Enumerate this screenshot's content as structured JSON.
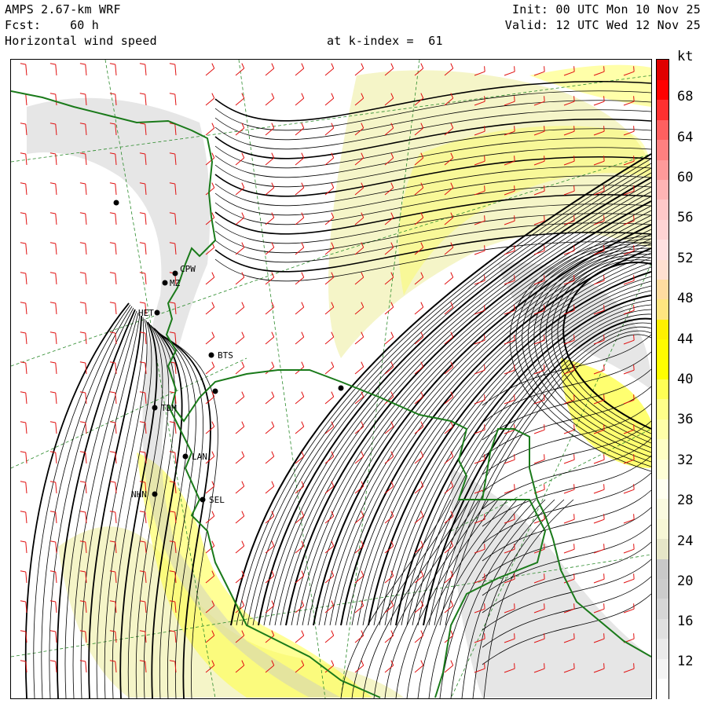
{
  "header": {
    "model": "AMPS 2.67-km WRF",
    "forecast": "Fcst:    60 h",
    "field": "Horizontal wind speed",
    "level": "at k-index =  61",
    "init": "Init: 00 UTC Mon 10 Nov 25",
    "valid": "Valid: 12 UTC Wed 12 Nov 25"
  },
  "colorbar": {
    "unit": "kt",
    "labels": [
      "68",
      "64",
      "60",
      "56",
      "52",
      "48",
      "44",
      "40",
      "36",
      "32",
      "28",
      "24",
      "20",
      "16",
      "12"
    ],
    "levels": [
      {
        "min": 0,
        "color": "#ffffff"
      },
      {
        "min": 10,
        "color": "#f4f4f4"
      },
      {
        "min": 12,
        "color": "#eaeaea"
      },
      {
        "min": 14,
        "color": "#e0e0e0"
      },
      {
        "min": 16,
        "color": "#d6d6d6"
      },
      {
        "min": 18,
        "color": "#cccccc"
      },
      {
        "min": 20,
        "color": "#c8c8c8"
      },
      {
        "min": 22,
        "color": "#e6e6c8"
      },
      {
        "min": 24,
        "color": "#f7f7d6"
      },
      {
        "min": 26,
        "color": "#fafae0"
      },
      {
        "min": 28,
        "color": "#fffff0"
      },
      {
        "min": 30,
        "color": "#ffffd6"
      },
      {
        "min": 32,
        "color": "#ffffc4"
      },
      {
        "min": 34,
        "color": "#ffffa8"
      },
      {
        "min": 36,
        "color": "#ffff8a"
      },
      {
        "min": 38,
        "color": "#ffff55"
      },
      {
        "min": 40,
        "color": "#ffff00"
      },
      {
        "min": 42,
        "color": "#fffb00"
      },
      {
        "min": 44,
        "color": "#fff000"
      },
      {
        "min": 46,
        "color": "#ffe680"
      },
      {
        "min": 48,
        "color": "#ffdca0"
      },
      {
        "min": 50,
        "color": "#ffe0d0"
      },
      {
        "min": 52,
        "color": "#ffe0e0"
      },
      {
        "min": 54,
        "color": "#ffd4d4"
      },
      {
        "min": 56,
        "color": "#ffc8c8"
      },
      {
        "min": 58,
        "color": "#ffb4b4"
      },
      {
        "min": 60,
        "color": "#ff9a9a"
      },
      {
        "min": 62,
        "color": "#ff8080"
      },
      {
        "min": 64,
        "color": "#ff6060"
      },
      {
        "min": 66,
        "color": "#ff3030"
      },
      {
        "min": 68,
        "color": "#ff0000"
      },
      {
        "min": 70,
        "color": "#e00000"
      }
    ]
  },
  "stations": [
    {
      "id": "CPW"
    },
    {
      "id": "MZ"
    },
    {
      "id": "HET"
    },
    {
      "id": "BTS"
    },
    {
      "id": "TDM"
    },
    {
      "id": "LAN"
    },
    {
      "id": "NHN"
    },
    {
      "id": "SEL"
    }
  ],
  "colors": {
    "coastline": "#1a7a1a",
    "streamline": "#000000",
    "wind_barb": "#e01010",
    "latlon_grid": "#2a8a2a",
    "fast_wind": "#ffff40",
    "moderate_wind": "#f5f5c8",
    "terrain_shade": "#c8c8c8"
  }
}
